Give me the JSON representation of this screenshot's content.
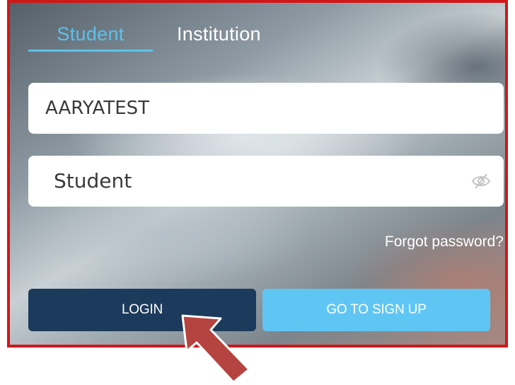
{
  "tabs": {
    "student": "Student",
    "institution": "Institution"
  },
  "fields": {
    "username_value": "AARYATEST",
    "password_value": "Student"
  },
  "links": {
    "forgot_password": "Forgot password?"
  },
  "buttons": {
    "login": "LOGIN",
    "signup": "GO TO SIGN UP"
  },
  "icons": {
    "password_toggle": "eye-off-icon",
    "pointer": "arrow-pointer-icon"
  },
  "colors": {
    "active_tab": "#5bc2ec",
    "login_button": "#1c3b5c",
    "signup_button": "#5fc6f3",
    "highlight_border": "#d11717",
    "arrow": "#b5433f"
  }
}
